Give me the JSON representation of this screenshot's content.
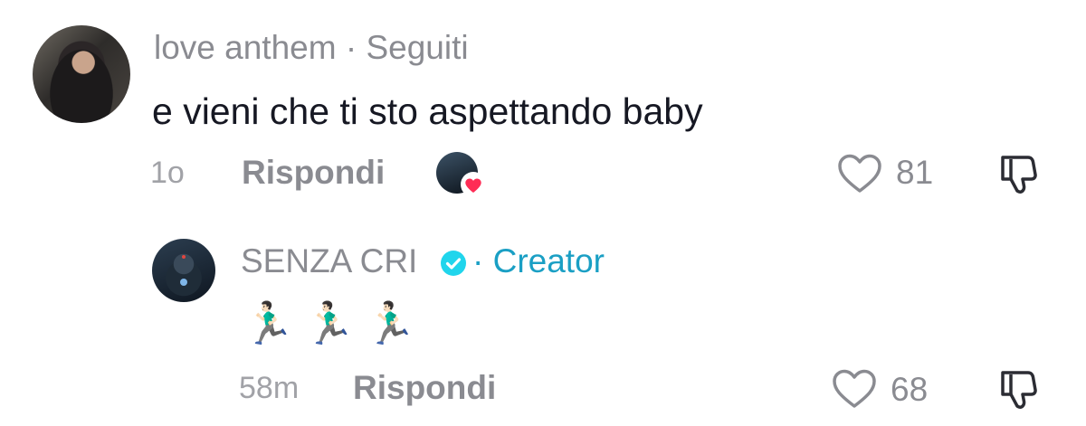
{
  "comment": {
    "username": "love anthem",
    "separator": "·",
    "relation": "Seguiti",
    "text": "e vieni che ti sto aspettando baby",
    "time": "1o",
    "reply_label": "Rispondi",
    "like_count": "81",
    "creator_liked": true,
    "creator_liked_icon": "heart-icon"
  },
  "reply": {
    "username": "SENZA CRI",
    "verified_icon": "verified-check-icon",
    "separator": "·",
    "badge": "Creator",
    "text": "🏃🏻‍♂️🏃🏻‍♂️🏃🏻‍♂️",
    "time": "58m",
    "reply_label": "Rispondi",
    "like_count": "68"
  },
  "colors": {
    "text_primary": "#161823",
    "text_secondary": "#8a8b91",
    "creator_accent": "#1a9fc4",
    "heart_red": "#fe2c55"
  }
}
